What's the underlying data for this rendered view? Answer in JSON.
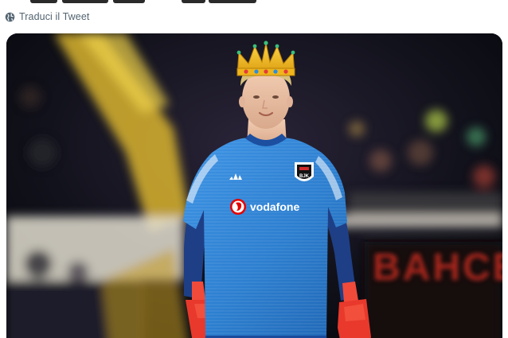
{
  "tweet": {
    "translate_label": "Traduci il Tweet",
    "translate_icon": "globe-icon"
  },
  "media": {
    "sponsor_text": "vodafone",
    "crest_letters": "BJK",
    "kit_brand_icon": "adidas-logo-icon",
    "overlay_icon": "crown-icon",
    "banner_text": "BAHCE"
  },
  "colors": {
    "link_gray": "#536471",
    "kit_blue": "#2d7fd0",
    "glove_red": "#e8392c",
    "crown_gold": "#f2c21b"
  }
}
